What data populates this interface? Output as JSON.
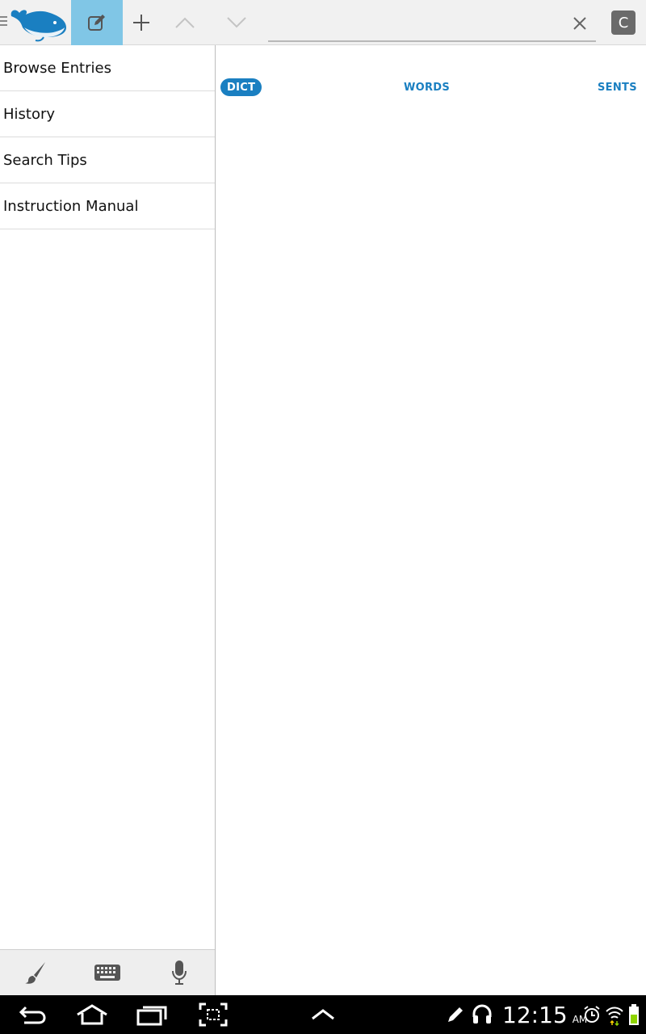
{
  "toolbar": {
    "search_value": "",
    "search_placeholder": "",
    "c_button_label": "C"
  },
  "sidebar": {
    "items": [
      {
        "label": "Browse Entries"
      },
      {
        "label": "History"
      },
      {
        "label": "Search Tips"
      },
      {
        "label": "Instruction Manual"
      }
    ]
  },
  "tabs": [
    {
      "label": "DICT",
      "selected": true
    },
    {
      "label": "WORDS",
      "selected": false
    },
    {
      "label": "SENTS",
      "selected": false
    }
  ],
  "status_bar": {
    "time": "12:15",
    "ampm": "AM"
  },
  "colors": {
    "accent": "#1a7fc1",
    "selected_toolbar_button": "#80c6e6",
    "nav_bar": "#000000"
  },
  "icons": [
    "menu-icon",
    "whale-logo",
    "edit-icon",
    "plus-icon",
    "chevron-up-icon",
    "chevron-down-icon",
    "close-icon",
    "brush-icon",
    "keyboard-icon",
    "microphone-icon",
    "back-icon",
    "home-icon",
    "recent-apps-icon",
    "screenshot-icon",
    "chevron-up-icon",
    "pen-icon",
    "headphones-icon",
    "alarm-icon",
    "wifi-icon",
    "battery-icon"
  ]
}
